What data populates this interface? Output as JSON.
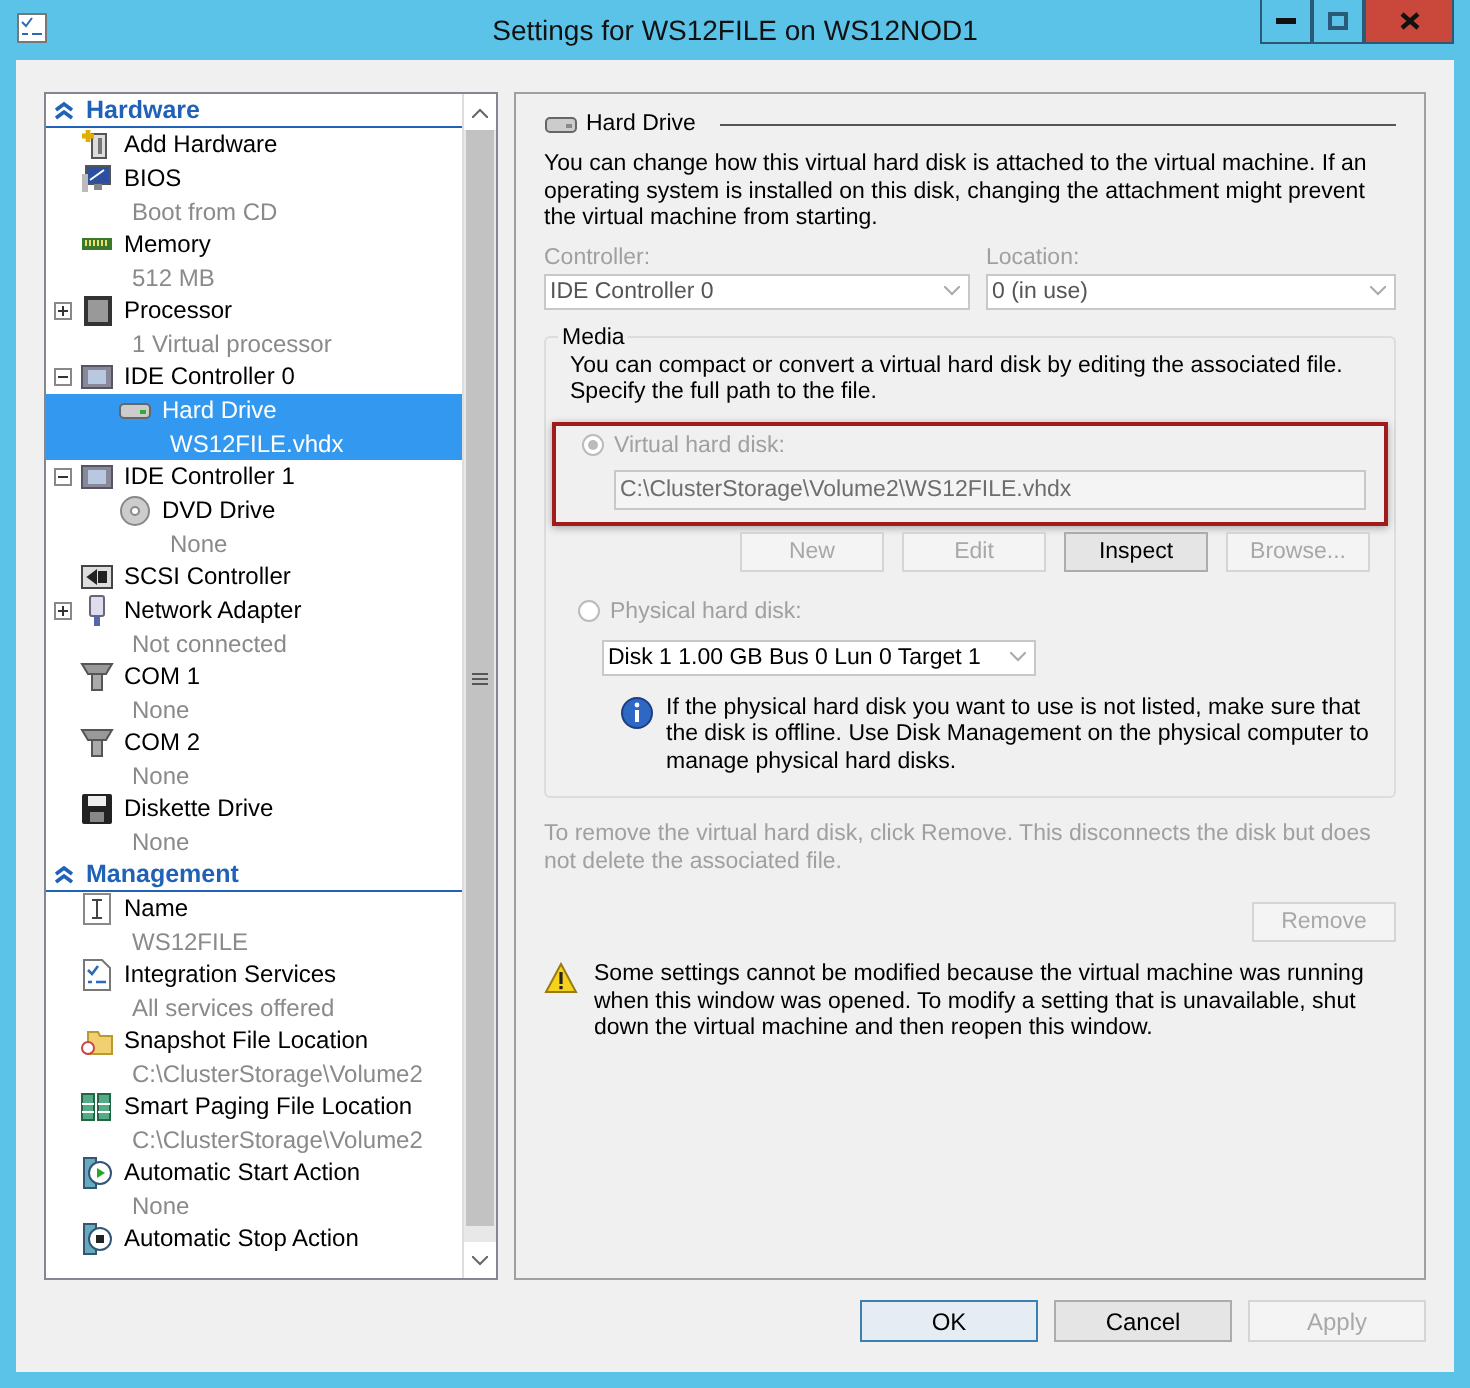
{
  "window": {
    "title": "Settings for WS12FILE on WS12NOD1"
  },
  "sidebar": {
    "sections": [
      {
        "title": "Hardware",
        "expanded": true,
        "items": [
          {
            "kind": "add",
            "label": "Add Hardware",
            "selected": false
          },
          {
            "kind": "bios",
            "label": "BIOS",
            "detail": "Boot from CD",
            "selected": false
          },
          {
            "kind": "memory",
            "label": "Memory",
            "detail": "512 MB",
            "selected": false
          },
          {
            "kind": "cpu",
            "label": "Processor",
            "detail": "1 Virtual processor",
            "expanded": false,
            "selected": false
          },
          {
            "kind": "controller",
            "label": "IDE Controller 0",
            "expanded": true,
            "selected": false,
            "children": [
              {
                "kind": "disk",
                "label": "Hard Drive",
                "detail": "WS12FILE.vhdx",
                "selected": true
              }
            ]
          },
          {
            "kind": "controller",
            "label": "IDE Controller 1",
            "expanded": true,
            "selected": false,
            "children": [
              {
                "kind": "dvd",
                "label": "DVD Drive",
                "detail": "None",
                "selected": false
              }
            ]
          },
          {
            "kind": "scsi",
            "label": "SCSI Controller",
            "selected": false
          },
          {
            "kind": "network",
            "label": "Network Adapter",
            "detail": "Not connected",
            "expanded": false,
            "selected": false
          },
          {
            "kind": "port",
            "label": "COM 1",
            "detail": "None",
            "selected": false
          },
          {
            "kind": "port",
            "label": "COM 2",
            "detail": "None",
            "selected": false
          },
          {
            "kind": "floppy",
            "label": "Diskette Drive",
            "detail": "None",
            "selected": false
          }
        ]
      },
      {
        "title": "Management",
        "expanded": true,
        "items": [
          {
            "kind": "name",
            "label": "Name",
            "detail": "WS12FILE",
            "selected": false
          },
          {
            "kind": "services",
            "label": "Integration Services",
            "detail": "All services offered",
            "selected": false
          },
          {
            "kind": "folder",
            "label": "Snapshot File Location",
            "detail": "C:\\ClusterStorage\\Volume2",
            "selected": false
          },
          {
            "kind": "paging",
            "label": "Smart Paging File Location",
            "detail": "C:\\ClusterStorage\\Volume2",
            "selected": false
          },
          {
            "kind": "start",
            "label": "Automatic Start Action",
            "detail": "None",
            "selected": false
          },
          {
            "kind": "stop",
            "label": "Automatic Stop Action",
            "selected": false
          }
        ]
      }
    ]
  },
  "content": {
    "heading": "Hard Drive",
    "description": "You can change how this virtual hard disk is attached to the virtual machine. If an operating system is installed on this disk, changing the attachment might prevent the virtual machine from starting.",
    "controller": {
      "label": "Controller:",
      "value": "IDE Controller 0",
      "disabled": true
    },
    "location": {
      "label": "Location:",
      "value": "0 (in use)",
      "disabled": true
    },
    "media": {
      "legend": "Media",
      "description": "You can compact or convert a virtual hard disk by editing the associated file. Specify the full path to the file.",
      "highlighted": true,
      "virtual": {
        "label": "Virtual hard disk:",
        "selected": true,
        "disabled": true,
        "path": "C:\\ClusterStorage\\Volume2\\WS12FILE.vhdx"
      },
      "buttons": [
        {
          "label": "New",
          "disabled": true
        },
        {
          "label": "Edit",
          "disabled": true
        },
        {
          "label": "Inspect",
          "disabled": false
        },
        {
          "label": "Browse...",
          "disabled": true
        }
      ],
      "physical": {
        "label": "Physical hard disk:",
        "selected": false,
        "disabled": true,
        "disk": "Disk 1 1.00 GB Bus 0 Lun 0 Target 1"
      },
      "info": "If the physical hard disk you want to use is not listed, make sure that the disk is offline. Use Disk Management on the physical computer to manage physical hard disks."
    },
    "remove_note": {
      "text": "To remove the virtual hard disk, click Remove. This disconnects the disk but does not delete the associated file.",
      "disabled": true
    },
    "remove_button": {
      "label": "Remove",
      "disabled": true
    },
    "warning": "Some settings cannot be modified because the virtual machine was running when this window was opened. To modify a setting that is unavailable, shut down the virtual machine and then reopen this window."
  },
  "buttons": [
    {
      "label": "OK",
      "disabled": false,
      "default": true
    },
    {
      "label": "Cancel",
      "disabled": false,
      "default": false
    },
    {
      "label": "Apply",
      "disabled": true,
      "default": false
    }
  ]
}
